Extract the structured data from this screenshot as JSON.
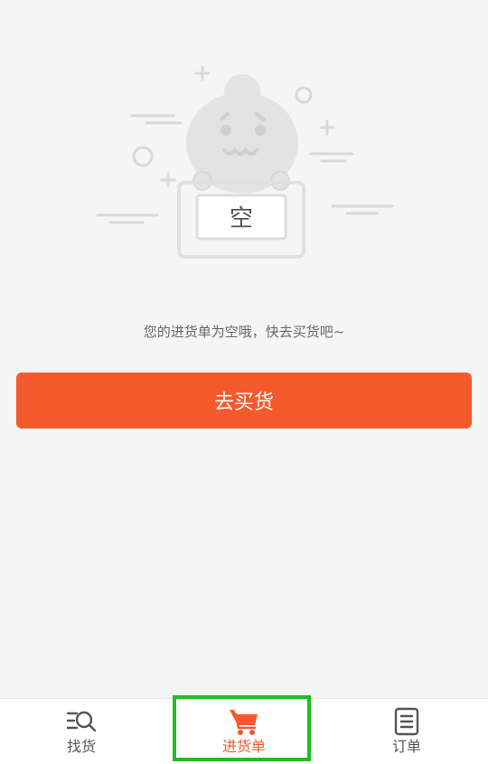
{
  "empty_state": {
    "mascot_sign_text": "空",
    "message": "您的进货单为空哦，快去买货吧~"
  },
  "actions": {
    "go_shopping_label": "去买货"
  },
  "tab_bar": {
    "tabs": [
      {
        "label": "找货",
        "icon": "search-list-icon",
        "active": false
      },
      {
        "label": "进货单",
        "icon": "cart-icon",
        "active": true
      },
      {
        "label": "订单",
        "icon": "order-list-icon",
        "active": false
      }
    ]
  },
  "colors": {
    "accent": "#f45a2b",
    "background": "#f5f5f5",
    "highlight": "#1fbf1f",
    "illustration": "#d8d8d8"
  }
}
